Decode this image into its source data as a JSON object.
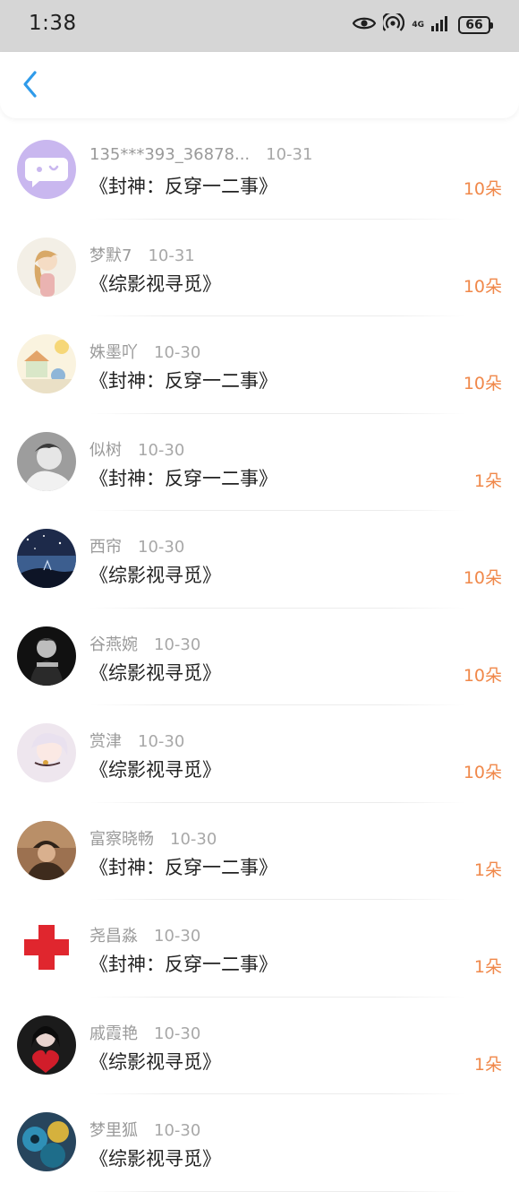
{
  "status_bar": {
    "time": "1:38",
    "network": "4G",
    "battery": "66"
  },
  "header": {
    "back_icon": "chevron-left-icon"
  },
  "colors": {
    "accent_blue": "#2f9bea",
    "amount_orange": "#f0884a"
  },
  "records": [
    {
      "name": "135***393_36878...",
      "date": "10-31",
      "book": "《封神：反穿一二事》",
      "amount": "10朵"
    },
    {
      "name": "梦默7",
      "date": "10-31",
      "book": "《综影视寻觅》",
      "amount": "10朵"
    },
    {
      "name": "姝墨吖",
      "date": "10-30",
      "book": "《封神：反穿一二事》",
      "amount": "10朵"
    },
    {
      "name": "似树",
      "date": "10-30",
      "book": "《封神：反穿一二事》",
      "amount": "1朵"
    },
    {
      "name": "西帘",
      "date": "10-30",
      "book": "《综影视寻觅》",
      "amount": "10朵"
    },
    {
      "name": "谷燕婉",
      "date": "10-30",
      "book": "《综影视寻觅》",
      "amount": "10朵"
    },
    {
      "name": "赏津",
      "date": "10-30",
      "book": "《综影视寻觅》",
      "amount": "10朵"
    },
    {
      "name": "富察晓畅",
      "date": "10-30",
      "book": "《封神：反穿一二事》",
      "amount": "1朵"
    },
    {
      "name": "尧昌淼",
      "date": "10-30",
      "book": "《封神：反穿一二事》",
      "amount": "1朵"
    },
    {
      "name": "戚霞艳",
      "date": "10-30",
      "book": "《综影视寻觅》",
      "amount": "1朵"
    },
    {
      "name": "梦里狐",
      "date": "10-30",
      "book": "《综影视寻觅》",
      "amount": ""
    }
  ]
}
